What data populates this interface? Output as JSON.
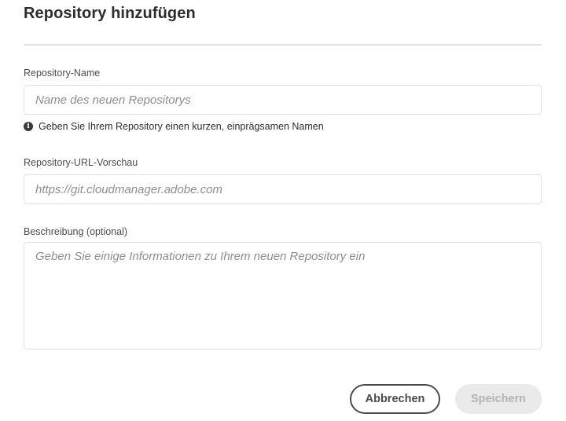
{
  "dialog": {
    "title": "Repository hinzufügen"
  },
  "fields": {
    "name": {
      "label": "Repository-Name",
      "placeholder": "Name des neuen Repositorys",
      "value": "",
      "hint": "Geben Sie Ihrem Repository einen kurzen, einprägsamen Namen",
      "hint_icon": "info-icon"
    },
    "url_preview": {
      "label": "Repository-URL-Vorschau",
      "placeholder": "https://git.cloudmanager.adobe.com",
      "value": ""
    },
    "description": {
      "label": "Beschreibung (optional)",
      "placeholder": "Geben Sie einige Informationen zu Ihrem neuen Repository ein",
      "value": ""
    }
  },
  "actions": {
    "cancel_label": "Abbrechen",
    "save_label": "Speichern",
    "save_enabled": false
  },
  "colors": {
    "border": "#e1e1e1",
    "text": "#2c2c2c",
    "placeholder": "#8e8e8e",
    "disabled_bg": "#eaeaea",
    "disabled_text": "#b3b3b3"
  }
}
